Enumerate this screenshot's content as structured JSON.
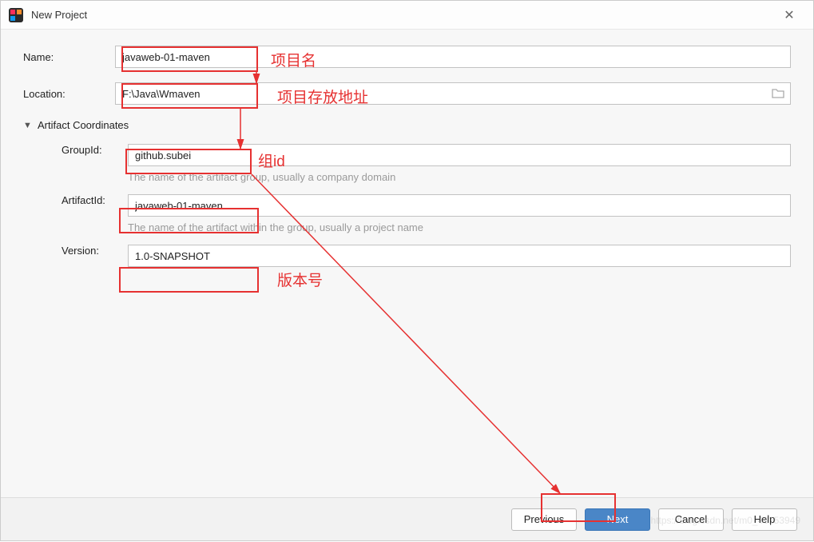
{
  "titlebar": {
    "title": "New Project"
  },
  "form": {
    "name_label": "Name:",
    "name_value": "javaweb-01-maven",
    "location_label": "Location:",
    "location_value": "F:\\Java\\Wmaven",
    "coords_header": "Artifact Coordinates",
    "groupId_label": "GroupId:",
    "groupId_value": "github.subei",
    "groupId_hint": "The name of the artifact group, usually a company domain",
    "artifactId_label": "ArtifactId:",
    "artifactId_value": "javaweb-01-maven",
    "artifactId_hint": "The name of the artifact within the group, usually a project name",
    "version_label": "Version:",
    "version_value": "1.0-SNAPSHOT"
  },
  "buttons": {
    "previous": "Previous",
    "next": "Next",
    "cancel": "Cancel",
    "help": "Help"
  },
  "annotations": {
    "name": "项目名",
    "location": "项目存放地址",
    "groupId": "组id",
    "version": "版本号"
  }
}
